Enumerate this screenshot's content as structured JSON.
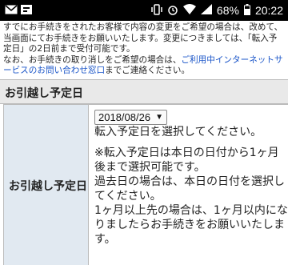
{
  "statusbar": {
    "battery": "68%",
    "time": "20:22"
  },
  "intro": {
    "line1": "すでにお手続きをされたお客様で内容の変更をご希望の場合は、改めて、当画面にてお手続きをお願いいたします。変更につきましては、「転入予定日」の2日前まで受付可能です。",
    "line2_prefix": "なお、お手続きの取り消しをご希望の場合は、",
    "line2_link": "ご利用中インターネットサービスのお問い合わせ窓口",
    "line2_suffix": "までご連絡ください。"
  },
  "section": {
    "title": "お引越し予定日",
    "row_label": "お引越し予定日",
    "date_value": "2018/08/26",
    "instruction": "転入予定日を選択してください。",
    "note1": "※転入予定日は本日の日付から1ヶ月後まで選択可能です。",
    "note2": "過去日の場合は、本日の日付を選択してください。",
    "note3": "1ヶ月以上先の場合は、1ヶ月以内になりましたらお手続きをお願いいたします。"
  }
}
